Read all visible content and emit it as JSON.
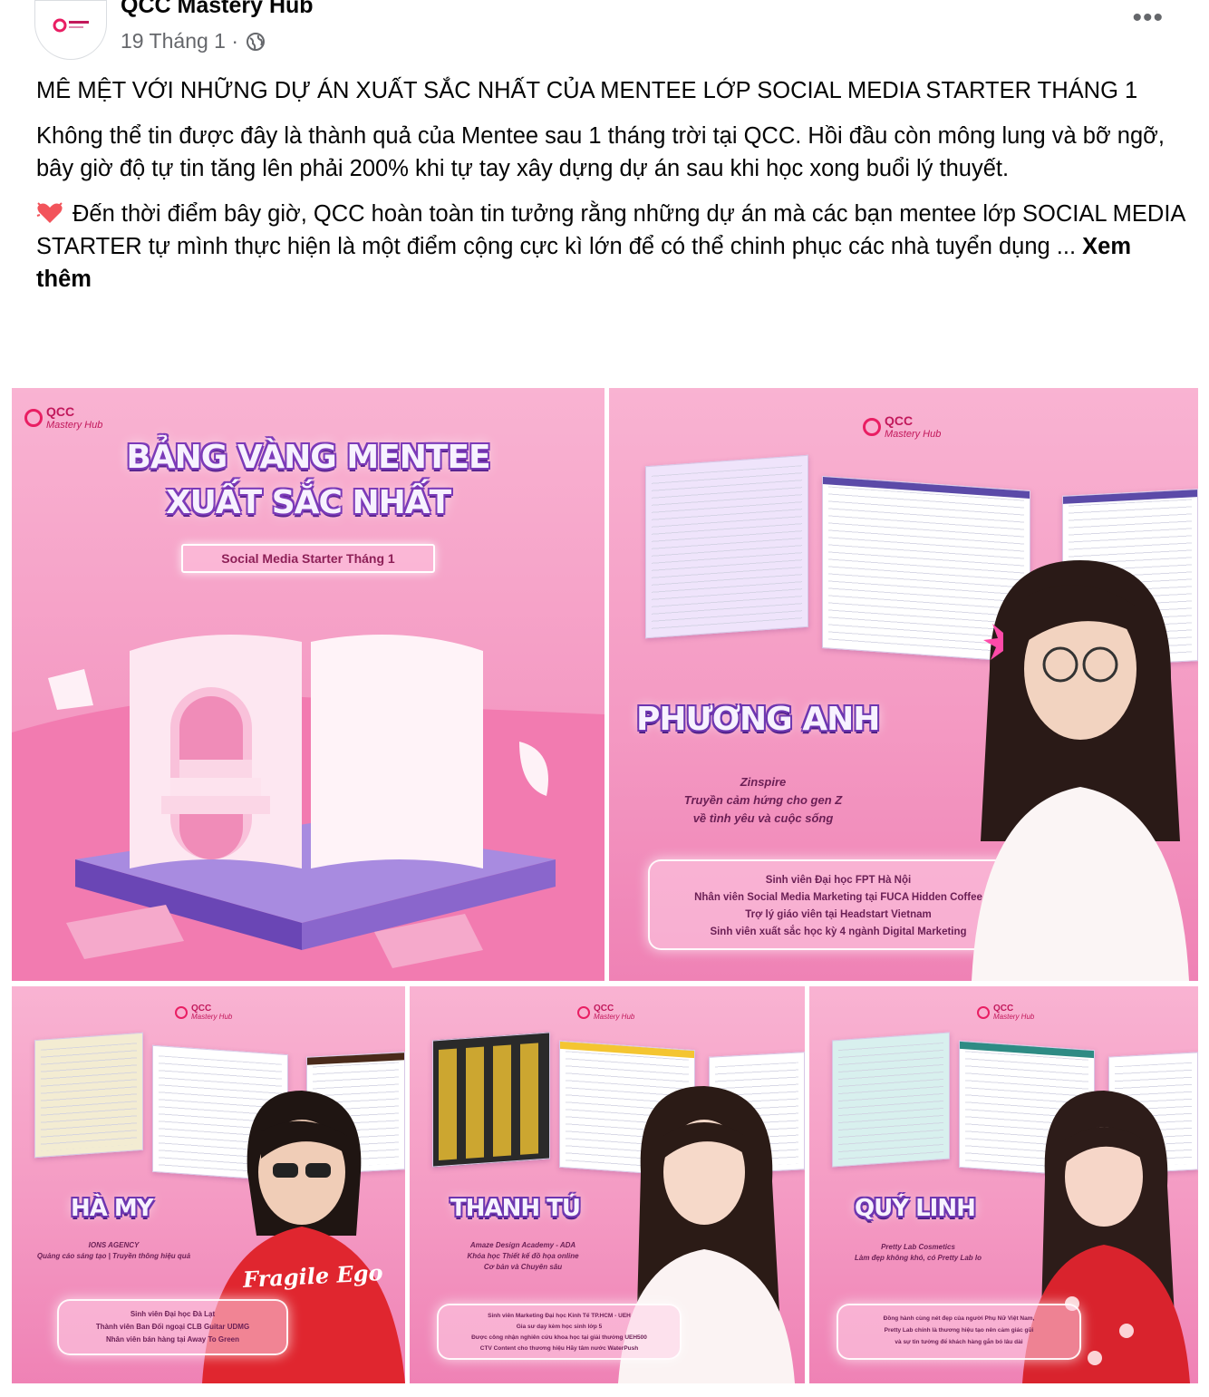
{
  "post": {
    "page_name": "QCC Mastery Hub",
    "date": "19 Tháng 1 ·",
    "headline": "MÊ MỆT VỚI NHỮNG DỰ ÁN XUẤT SẮC NHẤT CỦA MENTEE LỚP SOCIAL MEDIA STARTER THÁNG 1",
    "paragraph1": "Không thể tin được đây là thành quả của Mentee sau 1 tháng trời tại QCC. Hồi đầu còn mông lung và bỡ ngỡ, bây giờ độ tự tin tăng lên phải 200% khi tự tay xây dựng dự án sau khi học xong buổi lý thuyết.",
    "paragraph2": "Đến thời điểm bây giờ, QCC hoàn toàn tin tưởng rằng những dự án mà các bạn mentee lớp SOCIAL MEDIA STARTER tự mình thực hiện là một điểm cộng cực kì lớn để có thể chinh phục các nhà tuyển dụng ...",
    "see_more": "Xem thêm"
  },
  "logo": {
    "line1": "QCC",
    "line2": "Mastery Hub"
  },
  "tile1": {
    "title_line1": "BẢNG VÀNG MENTEE",
    "title_line2": "XUẤT SẮC NHẤT",
    "pill": "Social Media Starter Tháng 1"
  },
  "tile2": {
    "name": "PHƯƠNG ANH",
    "tag1": "Zinspire",
    "tag2": "Truyền cảm hứng cho gen Z",
    "tag3": "về tình yêu và cuộc sống",
    "info": [
      "Sinh viên Đại học FPT Hà Nội",
      "Nhân viên Social Media Marketing tại FUCA Hidden Coffee",
      "Trợ lý giáo viên tại Headstart Vietnam",
      "Sinh viên xuất sắc học kỳ 4 ngành Digital Marketing"
    ]
  },
  "tile3": {
    "name": "HÀ MY",
    "tag1": "IONS AGENCY",
    "tag2": "Quảng cáo sáng tạo | Truyền thông hiệu quả",
    "shirt": "Fragile Ego",
    "info": [
      "Sinh viên Đại học Đà Lạt",
      "Thành viên Ban Đối ngoại CLB Guitar UDMG",
      "Nhân viên bán hàng tại Away To Green"
    ]
  },
  "tile4": {
    "name": "THANH TÚ",
    "tag1": "Amaze Design Academy - ADA",
    "tag2": "Khóa học Thiết kế đồ họa online",
    "tag3": "Cơ bản và Chuyên sâu",
    "info": [
      "Sinh viên Marketing Đại học Kinh Tế TP.HCM - UEH",
      "Gia sư dạy kèm học sinh lớp 5",
      "Được công nhận nghiên cứu khoa học tại giải thưởng UEH500",
      "CTV Content cho thương hiệu Hãy tâm nước WaterPush"
    ]
  },
  "tile5": {
    "name": "QUÝ LINH",
    "tag1": "Pretty Lab Cosmetics",
    "tag2": "Làm đẹp không khó, có Pretty Lab lo",
    "info": [
      "Đồng hành cùng nét đẹp của người Phụ Nữ Việt Nam,",
      "Pretty Lab chính là thương hiệu tạo nên cảm giác gũi",
      "và sự tin tưởng để khách hàng gắn bó lâu dài"
    ]
  },
  "colors": {
    "tile_pink": "#f49ac3",
    "accent_purple": "#6d36b0",
    "text_dark": "#050505",
    "meta_gray": "#65676b"
  },
  "icons": [
    "globe-icon",
    "more-options-icon",
    "heart-icon"
  ]
}
